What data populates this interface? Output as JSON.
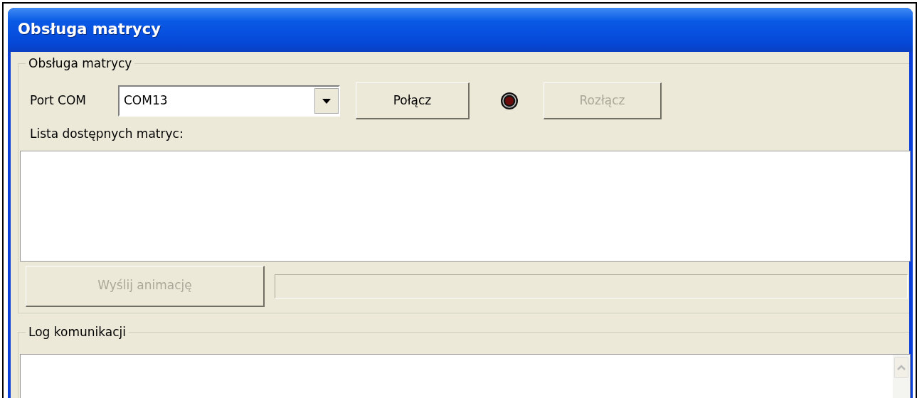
{
  "window": {
    "title": "Obsługa matrycy"
  },
  "matrix_group": {
    "legend": "Obsługa matrycy",
    "port_label": "Port COM",
    "port_combo": {
      "value": "COM13"
    },
    "connect_button": {
      "label": "Połącz",
      "disabled": false
    },
    "led": {
      "on": false
    },
    "disconnect_button": {
      "label": "Rozłącz",
      "disabled": true
    },
    "list_label": "Lista dostępnych matryc:",
    "send_button": {
      "label": "Wyślij animację",
      "disabled": true
    },
    "progress": {
      "level": 0
    }
  },
  "log_group": {
    "legend": "Log komunikacji"
  }
}
